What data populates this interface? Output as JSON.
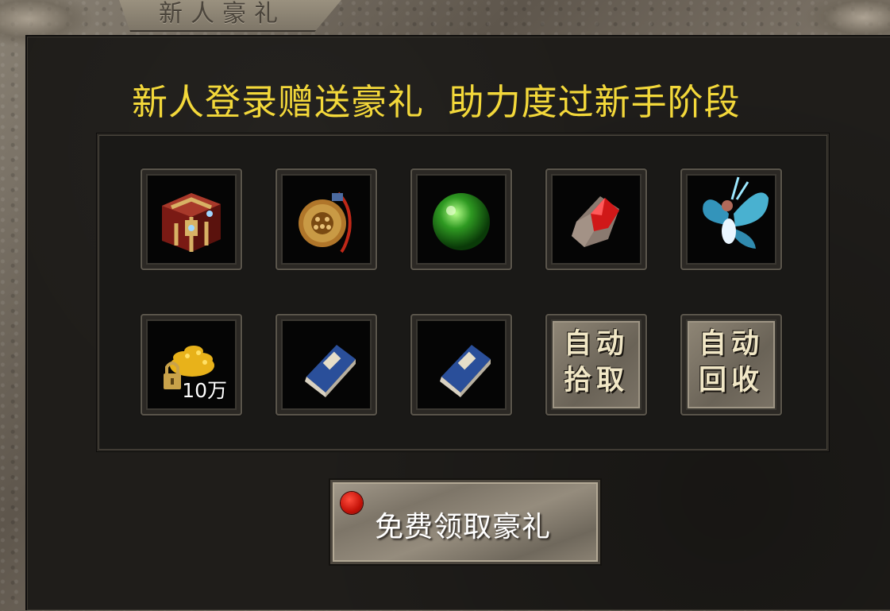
{
  "window": {
    "title": "新人豪礼"
  },
  "headline": "新人登录赠送豪礼  助力度过新手阶段",
  "items_row1": [
    {
      "icon": "treasure-chest-icon"
    },
    {
      "icon": "bronze-medallion-icon"
    },
    {
      "icon": "green-orb-icon"
    },
    {
      "icon": "red-gem-icon"
    },
    {
      "icon": "fairy-wings-icon"
    }
  ],
  "items_row2": [
    {
      "icon": "locked-gold-icon",
      "amount": "10万"
    },
    {
      "icon": "blue-skill-book-icon"
    },
    {
      "icon": "blue-skill-book-icon"
    },
    {
      "text_line1": "自动",
      "text_line2": "拾取"
    },
    {
      "text_line1": "自动",
      "text_line2": "回收"
    }
  ],
  "claim_button": {
    "label": "免费领取豪礼"
  },
  "colors": {
    "headline": "#f3d83a",
    "notification_dot": "#d81b10"
  }
}
